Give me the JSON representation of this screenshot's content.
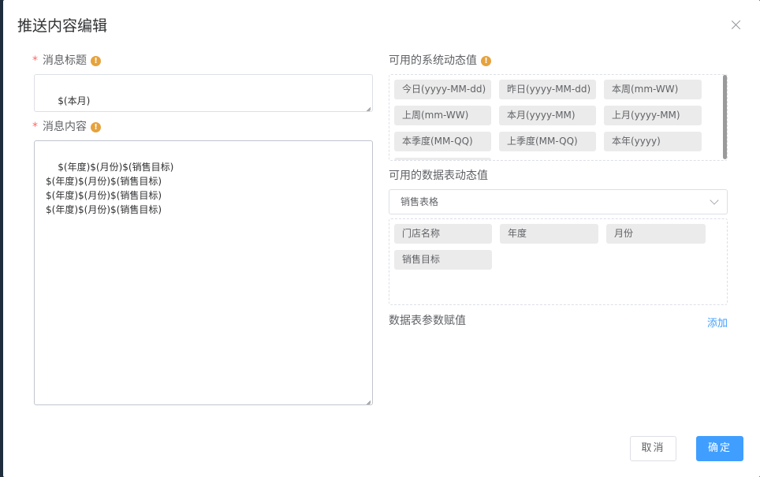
{
  "dialog": {
    "title": "推送内容编辑",
    "close_icon": "close-icon"
  },
  "left": {
    "title_field": {
      "required_mark": "*",
      "label": "消息标题",
      "value": "$(本月)"
    },
    "content_field": {
      "required_mark": "*",
      "label": "消息内容",
      "value": "$(年度)$(月份)$(销售目标)\n$(年度)$(月份)$(销售目标)\n$(年度)$(月份)$(销售目标)\n$(年度)$(月份)$(销售目标)"
    }
  },
  "right": {
    "system_values": {
      "label": "可用的系统动态值",
      "tags": [
        "今日(yyyy-MM-dd)",
        "昨日(yyyy-MM-dd)",
        "本周(mm-WW)",
        "上周(mm-WW)",
        "本月(yyyy-MM)",
        "上月(yyyy-MM)",
        "本季度(MM-QQ)",
        "上季度(MM-QQ)",
        "本年(yyyy)"
      ]
    },
    "table_values": {
      "label": "可用的数据表动态值",
      "selected_table": "销售表格",
      "tags": [
        "门店名称",
        "年度",
        "月份",
        "销售目标"
      ]
    },
    "params": {
      "label": "数据表参数赋值",
      "add_link": "添加"
    }
  },
  "footer": {
    "cancel_label": "取消",
    "ok_label": "确定"
  },
  "colors": {
    "accent": "#409eff",
    "required": "#f56c6c",
    "warning": "#e6a23c"
  }
}
